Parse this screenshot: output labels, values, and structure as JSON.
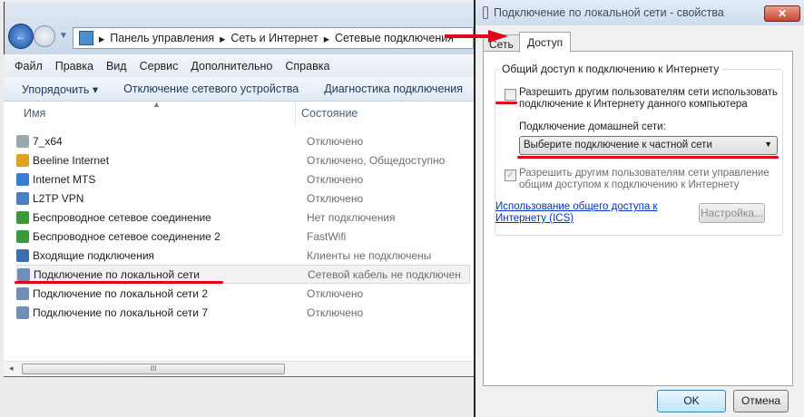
{
  "explorer": {
    "breadcrumb": [
      "Панель управления",
      "Сеть и Интернет",
      "Сетевые подключения"
    ],
    "menu": [
      "Файл",
      "Правка",
      "Вид",
      "Сервис",
      "Дополнительно",
      "Справка"
    ],
    "toolbar": [
      "Упорядочить ▾",
      "Отключение сетевого устройства",
      "Диагностика подключения"
    ],
    "columns": {
      "name": "Имя",
      "status": "Состояние"
    },
    "items": [
      {
        "name": "7_x64",
        "status": "Отключено"
      },
      {
        "name": "Beeline Internet",
        "status": "Отключено, Общедоступно"
      },
      {
        "name": "Internet MTS",
        "status": "Отключено"
      },
      {
        "name": "L2TP VPN",
        "status": "Отключено"
      },
      {
        "name": "Беспроводное сетевое соединение",
        "status": "Нет подключения"
      },
      {
        "name": "Беспроводное сетевое соединение 2",
        "status": "FastWifi"
      },
      {
        "name": "Входящие подключения",
        "status": "Клиенты не подключены"
      },
      {
        "name": "Подключение по локальной сети",
        "status": "Сетевой кабель не подключен",
        "selected": true
      },
      {
        "name": "Подключение по локальной сети 2",
        "status": "Отключено"
      },
      {
        "name": "Подключение по локальной сети 7",
        "status": "Отключено"
      }
    ],
    "scroll_grip": "III"
  },
  "dialog": {
    "title": "Подключение по локальной сети - свойства",
    "close": "✕",
    "tabs": [
      "Сеть",
      "Доступ"
    ],
    "group_title": "Общий доступ к подключению к Интернету",
    "allow_share": "Разрешить другим пользователям сети использовать подключение к Интернету данного компьютера",
    "home_label": "Подключение домашней сети:",
    "home_select": "Выберите подключение к частной сети",
    "allow_control": "Разрешить другим пользователям сети управление общим доступом к подключению к Интернету",
    "ics_link": "Использование общего доступа к Интернету (ICS)",
    "settings": "Настройка...",
    "ok": "OK",
    "cancel": "Отмена"
  },
  "colors": {
    "annotation": "#e0001a",
    "link": "#0033cc"
  }
}
